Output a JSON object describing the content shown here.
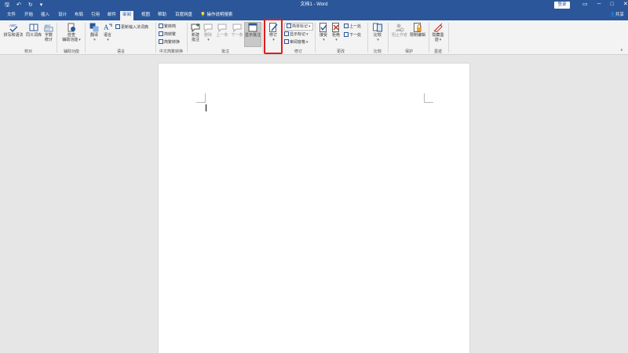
{
  "titlebar": {
    "qat": {
      "save": "🖫",
      "undo": "↶",
      "redo": "↻",
      "customize": "▾"
    },
    "title": "文档1 - Word",
    "login": "登录",
    "window": {
      "options": "▭",
      "minimize": "─",
      "maximize": "□",
      "close": "✕"
    }
  },
  "tabs": [
    "文件",
    "开始",
    "插入",
    "设计",
    "布局",
    "引用",
    "邮件",
    "审阅",
    "视图",
    "帮助",
    "百度网盘"
  ],
  "active_tab": "审阅",
  "tellme": "操作说明搜索",
  "share": "共享",
  "ribbon": {
    "proofing": {
      "label": "校对",
      "spelling": "拼写和语法",
      "thesaurus": "同义词库",
      "wordcount_l1": "字数",
      "wordcount_l2": "统计",
      "abc": "ABC",
      "num": "123"
    },
    "accessibility": {
      "label": "辅助功能",
      "check_l1": "检查",
      "check_l2": "辅助功能"
    },
    "language": {
      "label": "语言",
      "translate": "翻译",
      "language": "语言",
      "ime": "更新输入法词典"
    },
    "chinese": {
      "label": "中文简繁转换",
      "to_trad": "繁转简",
      "to_simp": "简转繁",
      "convert": "简繁转换"
    },
    "comments": {
      "label": "批注",
      "new_l1": "新建",
      "new_l2": "批注",
      "delete": "删除",
      "prev": "上一条",
      "next": "下一条",
      "show": "显示批注"
    },
    "tracking": {
      "label": "修订",
      "track": "修订",
      "simple_markup": "简单标记",
      "show_markup": "显示标记",
      "pane": "审阅窗格"
    },
    "changes": {
      "label": "更改",
      "accept": "接受",
      "reject": "拒绝",
      "prev": "上一处",
      "next": "下一处"
    },
    "compare": {
      "label": "比较",
      "compare": "比较"
    },
    "protect": {
      "label": "保护",
      "block": "阻止作者",
      "restrict": "限制编辑"
    },
    "ink": {
      "label": "墨迹",
      "hide_l1": "隐藏墨",
      "hide_l2": "迹"
    }
  },
  "colors": {
    "accent": "#2b579a",
    "highlight_box": "#e21c1c",
    "ribbon_bg": "#f3f3f3",
    "doc_bg": "#e6e6e6"
  }
}
